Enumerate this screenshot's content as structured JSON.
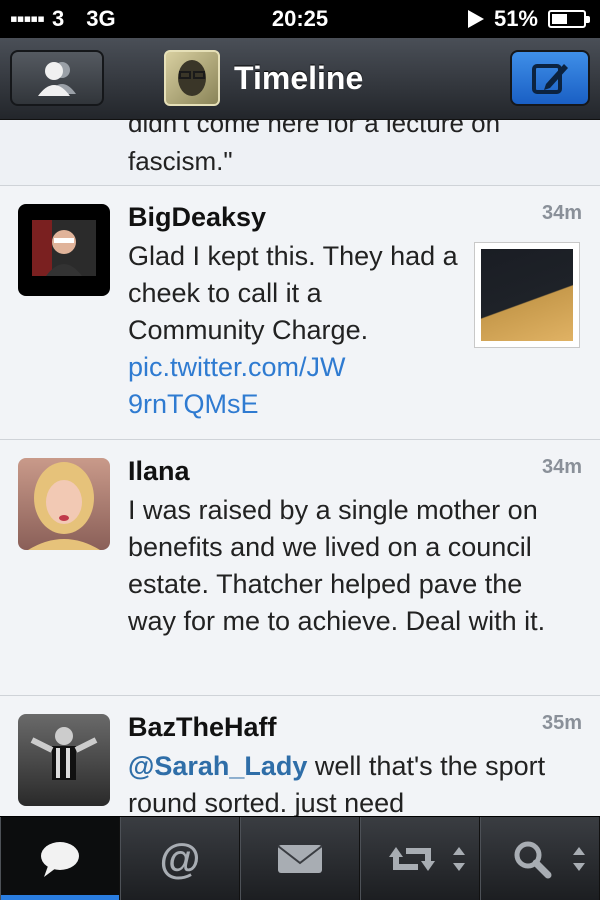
{
  "status_bar": {
    "carrier": "3",
    "network": "3G",
    "time": "20:25",
    "battery": "51%",
    "battery_level": 0.51
  },
  "nav": {
    "title": "Timeline",
    "accounts_icon": "people-icon",
    "compose_icon": "compose-icon"
  },
  "timeline": {
    "partial_text": "didn't come here for a lecture on\nfascism.\"",
    "tweets": [
      {
        "user": "BigDeaksy",
        "time": "34m",
        "text": "Glad I kept this. They had a cheek to call it a Community Charge.",
        "link": "pic.twitter.com/JW9rnTQMsE",
        "has_thumb": true
      },
      {
        "user": "Ilana",
        "time": "34m",
        "text": "I was raised by a single mother on benefits and we lived on a council estate. Thatcher helped pave the way for me to achieve. Deal with it."
      },
      {
        "user": "BazTheHaff",
        "time": "35m",
        "mention": "@Sarah_Lady",
        "text": " well that's the sport round sorted. just need"
      }
    ]
  },
  "tabs": [
    {
      "name": "timeline",
      "icon": "speech-bubble-icon",
      "active": true
    },
    {
      "name": "mentions",
      "icon": "at-icon"
    },
    {
      "name": "messages",
      "icon": "envelope-icon"
    },
    {
      "name": "retweets",
      "icon": "retweet-icon",
      "sort": true
    },
    {
      "name": "search",
      "icon": "search-icon",
      "sort": true
    }
  ],
  "colors": {
    "accent": "#2a7de0",
    "link": "#2f7bd1",
    "background": "#eef1f5"
  }
}
